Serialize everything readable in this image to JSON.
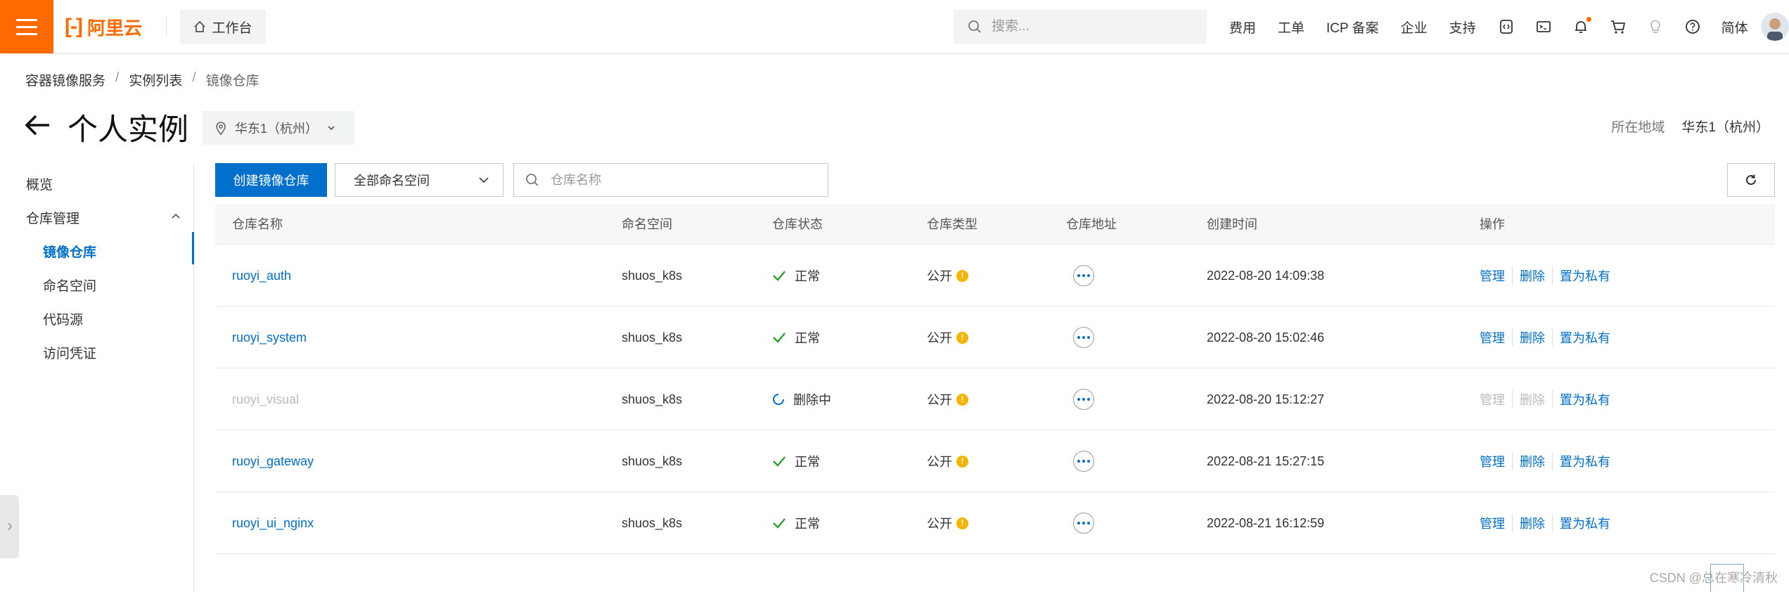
{
  "topbar": {
    "logo_text": "阿里云",
    "workbench_label": "工作台",
    "search_placeholder": "搜索...",
    "links": [
      "费用",
      "工单",
      "ICP 备案",
      "企业",
      "支持"
    ],
    "icons": [
      "code-icon",
      "terminal-icon",
      "bell-icon",
      "cart-icon",
      "bulb-icon",
      "help-icon"
    ],
    "lang_label": "简体",
    "accent_color": "#ff6a00"
  },
  "breadcrumb": [
    "容器镜像服务",
    "实例列表",
    "镜像仓库"
  ],
  "page": {
    "title": "个人实例",
    "region_selector": "华东1（杭州）",
    "region_label": "所在地域",
    "region_value": "华东1（杭州）"
  },
  "sidebar": {
    "overview": "概览",
    "group": "仓库管理",
    "items": [
      "镜像仓库",
      "命名空间",
      "代码源",
      "访问凭证"
    ],
    "active_index": 0
  },
  "toolbar": {
    "create_label": "创建镜像仓库",
    "namespace_select": "全部命名空间",
    "search_placeholder": "仓库名称"
  },
  "table": {
    "columns": [
      "仓库名称",
      "命名空间",
      "仓库状态",
      "仓库类型",
      "仓库地址",
      "创建时间",
      "操作"
    ],
    "rows": [
      {
        "name": "ruoyi_auth",
        "namespace": "shuos_k8s",
        "status": "正常",
        "type": "公开",
        "created": "2022-08-20 14:09:38",
        "state": "normal"
      },
      {
        "name": "ruoyi_system",
        "namespace": "shuos_k8s",
        "status": "正常",
        "type": "公开",
        "created": "2022-08-20 15:02:46",
        "state": "normal"
      },
      {
        "name": "ruoyi_visual",
        "namespace": "shuos_k8s",
        "status": "删除中",
        "type": "公开",
        "created": "2022-08-20 15:12:27",
        "state": "deleting"
      },
      {
        "name": "ruoyi_gateway",
        "namespace": "shuos_k8s",
        "status": "正常",
        "type": "公开",
        "created": "2022-08-21 15:27:15",
        "state": "normal"
      },
      {
        "name": "ruoyi_ui_nginx",
        "namespace": "shuos_k8s",
        "status": "正常",
        "type": "公开",
        "created": "2022-08-21 16:12:59",
        "state": "normal"
      }
    ],
    "actions": [
      "管理",
      "删除",
      "置为私有"
    ],
    "link_color": "#0070cc",
    "ok_color": "#2ca02c"
  },
  "watermark": "CSDN @总在寒冷清秋"
}
